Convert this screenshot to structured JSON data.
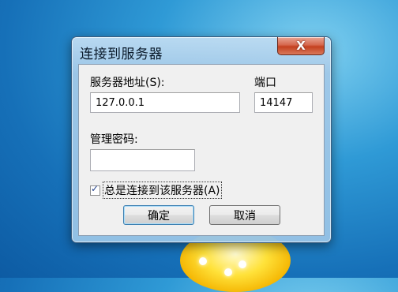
{
  "dialog": {
    "title": "连接到服务器",
    "close_label": "X"
  },
  "form": {
    "server_label": "服务器地址(S):",
    "server_value": "127.0.0.1",
    "port_label": "端口",
    "port_value": "14147",
    "password_label": "管理密码:",
    "password_value": "",
    "always_connect_label": "总是连接到该服务器(A)",
    "always_connect_checked": true
  },
  "buttons": {
    "ok_label": "确定",
    "cancel_label": "取消"
  }
}
